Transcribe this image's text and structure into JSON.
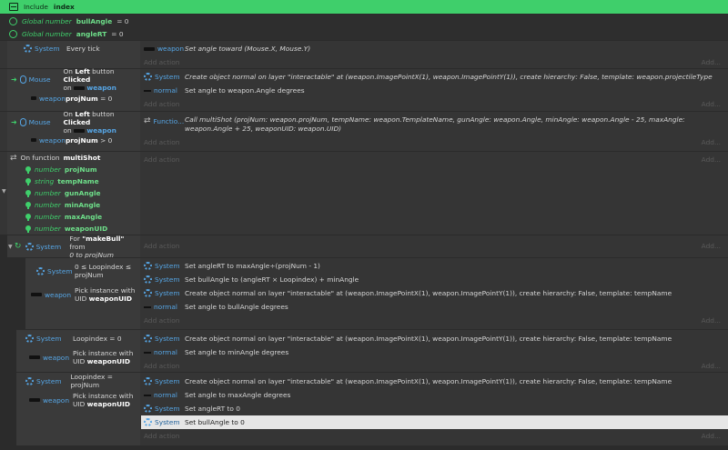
{
  "include": {
    "prefix": "Include",
    "name": "index"
  },
  "globals": [
    {
      "label": "Global number",
      "name": "bullAngle",
      "suffix": "= 0"
    },
    {
      "label": "Global number",
      "name": "angleRT",
      "suffix": "= 0"
    }
  ],
  "add_action": "Add action",
  "add_short": "Add...",
  "objects": {
    "system": "System",
    "mouse": "Mouse",
    "weapon": "weapon",
    "normal": "normal",
    "function": "Functio..."
  },
  "ev1": {
    "cond": "Every tick",
    "action": "Set angle toward (Mouse.X, Mouse.Y)"
  },
  "ev2": {
    "cond_pre": "On",
    "cond_btn": "Left",
    "cond_mid": "button",
    "cond_clicked": "Clicked",
    "cond_on": "on",
    "cond_obj": "weapon",
    "cond2_var": "projNum",
    "cond2_op": "= 0",
    "act1": "Create object  normal on layer \"interactable\" at (weapon.ImagePointX(1), weapon.ImagePointY(1)), create hierarchy: False, template: weapon.projectileType",
    "act2": "Set angle to weapon.Angle degrees"
  },
  "ev3": {
    "cond_pre": "On",
    "cond_btn": "Left",
    "cond_mid": "button",
    "cond_clicked": "Clicked",
    "cond_on": "on",
    "cond_obj": "weapon",
    "cond2_var": "projNum",
    "cond2_op": "> 0",
    "act1": "Call multiShot (projNum: weapon.projNum, tempName: weapon.TemplateName, gunAngle: weapon.Angle, minAngle: weapon.Angle - 25, maxAngle: weapon.Angle + 25, weaponUID: weapon.UID)"
  },
  "func": {
    "title_pre": "On function",
    "title": "multiShot",
    "params": [
      {
        "type": "number",
        "name": "projNum"
      },
      {
        "type": "string",
        "name": "tempName"
      },
      {
        "type": "number",
        "name": "gunAngle"
      },
      {
        "type": "number",
        "name": "minAngle"
      },
      {
        "type": "number",
        "name": "maxAngle"
      },
      {
        "type": "number",
        "name": "weaponUID"
      }
    ]
  },
  "loop": {
    "cond_pre": "For",
    "loopname": "\"makeBull\"",
    "from": "from",
    "range": "0 to projNum"
  },
  "sub1": {
    "cond1": "0 ≤ Loopindex ≤ projNum",
    "cond2_pre": "Pick instance with UID",
    "cond2_val": "weaponUID",
    "act1": "Set angleRT to maxAngle÷(projNum - 1)",
    "act2": "Set bullAngle to (angleRT × Loopindex) + minAngle",
    "act3": "Create object  normal on layer \"interactable\" at (weapon.ImagePointX(1), weapon.ImagePointY(1)), create hierarchy: False, template: tempName",
    "act4": "Set angle to bullAngle degrees"
  },
  "sub2": {
    "cond1": "Loopindex = 0",
    "cond2_pre": "Pick instance with UID",
    "cond2_val": "weaponUID",
    "act1": "Create object  normal on layer \"interactable\" at (weapon.ImagePointX(1), weapon.ImagePointY(1)), create hierarchy: False, template: tempName",
    "act2": "Set angle to minAngle degrees"
  },
  "sub3": {
    "cond1": "Loopindex = projNum",
    "cond2_pre": "Pick instance with UID",
    "cond2_val": "weaponUID",
    "act1": "Create object  normal on layer \"interactable\" at (weapon.ImagePointX(1), weapon.ImagePointY(1)), create hierarchy: False, template: tempName",
    "act2": "Set angle to maxAngle degrees",
    "act3": "Set angleRT to 0",
    "act4": "Set bullAngle to 0"
  },
  "colors": {
    "accent": "#3fcf6b",
    "object_blue": "#56a6e6",
    "bg": "#2b2b2b"
  }
}
